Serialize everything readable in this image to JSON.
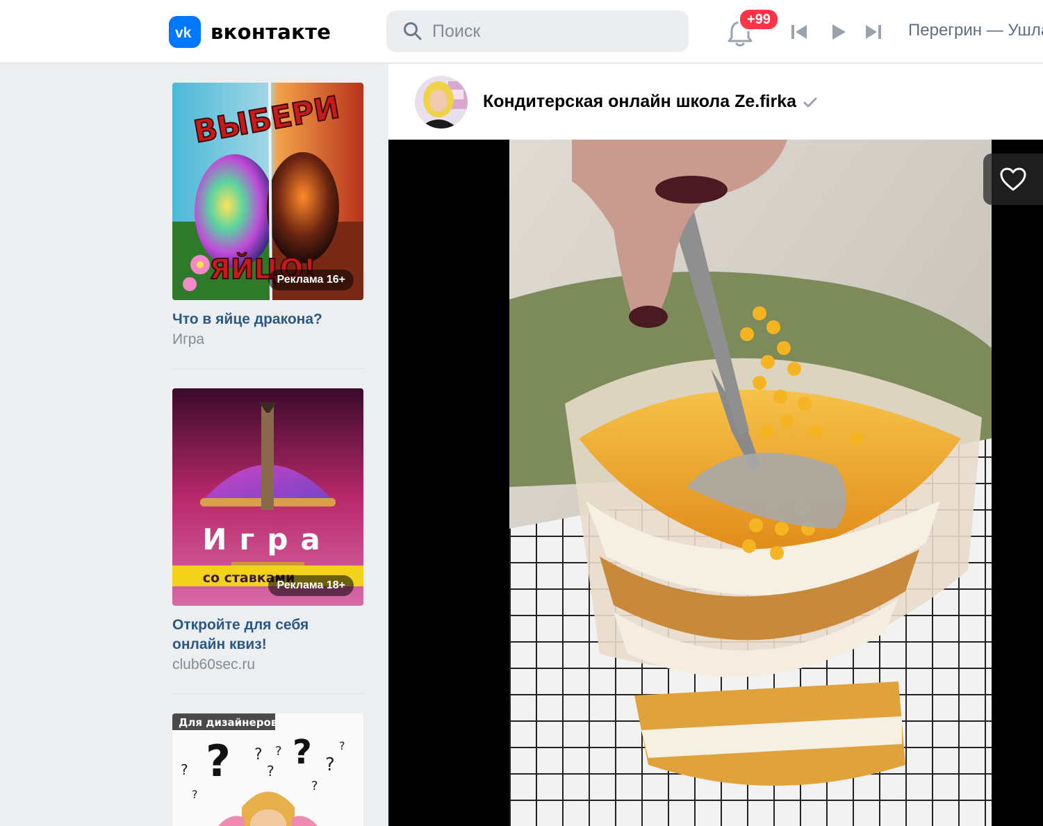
{
  "header": {
    "logo_text": "вконтакте",
    "search_placeholder": "Поиск",
    "notifications_badge": "+99",
    "player": {
      "prev_icon": "skip-back-icon",
      "play_icon": "play-icon",
      "next_icon": "skip-forward-icon",
      "track_title": "Перегрин — Ушла"
    }
  },
  "ads": [
    {
      "title": "Что в яйце дракона?",
      "subtitle": "Игра",
      "badge": "Реклама 16+",
      "image_text_top": "ВЫБЕРИ",
      "image_text_bottom": "ЯЙЦО!"
    },
    {
      "title": "Откройте для себя онлайн квиз!",
      "subtitle": "club60sec.ru",
      "badge": "Реклама 18+",
      "image_text_top": "Игра",
      "image_text_bottom": "со ставками"
    },
    {
      "image_tag": "Для дизайнеров"
    }
  ],
  "post": {
    "author": "Кондитерская онлайн школа Ze.firka",
    "verified_icon": "checkmark-icon",
    "like_icon": "heart-icon"
  },
  "colors": {
    "brand": "#0077ff",
    "badge": "#ff3347",
    "link": "#2a5885",
    "muted": "#818c99"
  }
}
